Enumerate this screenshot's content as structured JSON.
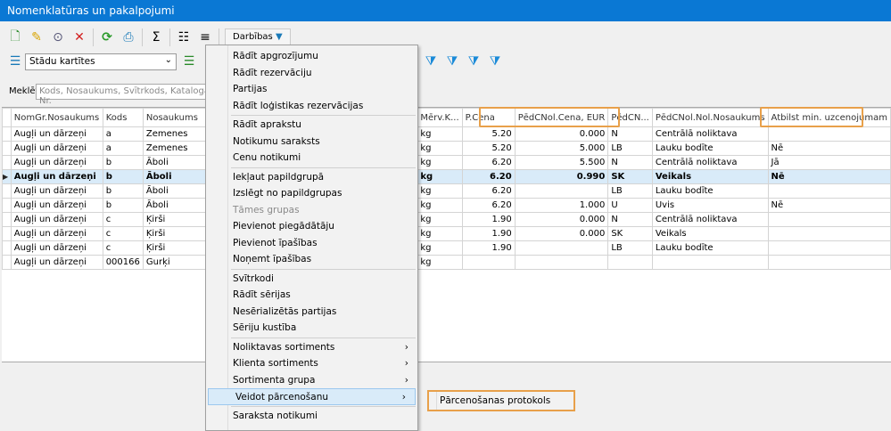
{
  "window": {
    "title": "Nomenklatūras un pakalpojumi"
  },
  "toolbar": {
    "actions_label": "Darbības"
  },
  "view": {
    "selected": "Stādu kartītes"
  },
  "search": {
    "label": "Meklēt",
    "placeholder": "Kods, Nosaukums, Svītrkods, Kataloga Nr."
  },
  "grid": {
    "columns": [
      "NomGr.Nosaukums",
      "Kods",
      "Nosaukums",
      "Mērv.K...",
      "P.Cena",
      "PēdCNol.Cena, EUR",
      "PēdCN...",
      "PēdCNol.Nol.Nosaukums",
      "Atbilst min. uzcenojumam"
    ],
    "rows": [
      [
        "Augļi un dārzeņi",
        "a",
        "Zemenes",
        "kg",
        "5.20",
        "0.000",
        "N",
        "Centrālā noliktava",
        ""
      ],
      [
        "Augļi un dārzeņi",
        "a",
        "Zemenes",
        "kg",
        "5.20",
        "5.000",
        "LB",
        "Lauku bodīte",
        "Nē"
      ],
      [
        "Augļi un dārzeņi",
        "b",
        "Āboli",
        "kg",
        "6.20",
        "5.500",
        "N",
        "Centrālā noliktava",
        "Jā"
      ],
      [
        "Augļi un dārzeņi",
        "b",
        "Āboli",
        "kg",
        "6.20",
        "0.990",
        "SK",
        "Veikals",
        "Nē"
      ],
      [
        "Augļi un dārzeņi",
        "b",
        "Āboli",
        "kg",
        "6.20",
        "",
        "LB",
        "Lauku bodīte",
        ""
      ],
      [
        "Augļi un dārzeņi",
        "b",
        "Āboli",
        "kg",
        "6.20",
        "1.000",
        "U",
        "Uvis",
        "Nē"
      ],
      [
        "Augļi un dārzeņi",
        "c",
        "Ķirši",
        "kg",
        "1.90",
        "0.000",
        "N",
        "Centrālā noliktava",
        ""
      ],
      [
        "Augļi un dārzeņi",
        "c",
        "Ķirši",
        "kg",
        "1.90",
        "0.000",
        "SK",
        "Veikals",
        ""
      ],
      [
        "Augļi un dārzeņi",
        "c",
        "Ķirši",
        "kg",
        "1.90",
        "",
        "LB",
        "Lauku bodīte",
        ""
      ],
      [
        "Augļi un dārzeņi",
        "000166",
        "Gurķi",
        "kg",
        "",
        "",
        "",
        "",
        ""
      ]
    ],
    "selected_row": 3
  },
  "menu": {
    "groups": [
      [
        "Rādīt apgrozījumu",
        "Rādīt rezervāciju",
        "Partijas",
        "Rādīt loģistikas rezervācijas"
      ],
      [
        "Rādīt aprakstu",
        "Notikumu saraksts",
        "Cenu notikumi"
      ],
      [
        "Iekļaut papildgrupā",
        "Izslēgt no papildgrupas",
        "Tāmes grupas",
        "Pievienot piegādātāju",
        "Pievienot īpašības",
        "Noņemt īpašības"
      ],
      [
        "Svītrkodi",
        "Rādīt sērijas",
        "Nesērializētās partijas",
        "Sēriju kustība"
      ],
      [
        "Noliktavas sortiments",
        "Klienta sortiments",
        "Sortimenta grupa",
        "Veidot pārcenošanu"
      ],
      [
        "Saraksta notikumi"
      ]
    ],
    "disabled": [
      "Tāmes grupas"
    ],
    "submenus": [
      "Noliktavas sortiments",
      "Klienta sortiments",
      "Sortimenta grupa",
      "Veidot pārcenošanu"
    ],
    "active": "Veidot pārcenošanu",
    "submenu_item": "Pārcenošanas protokols"
  },
  "colors": {
    "title_bar": "#0a78d4",
    "highlight": "#e8a04a",
    "selection": "#d9ebf9"
  }
}
